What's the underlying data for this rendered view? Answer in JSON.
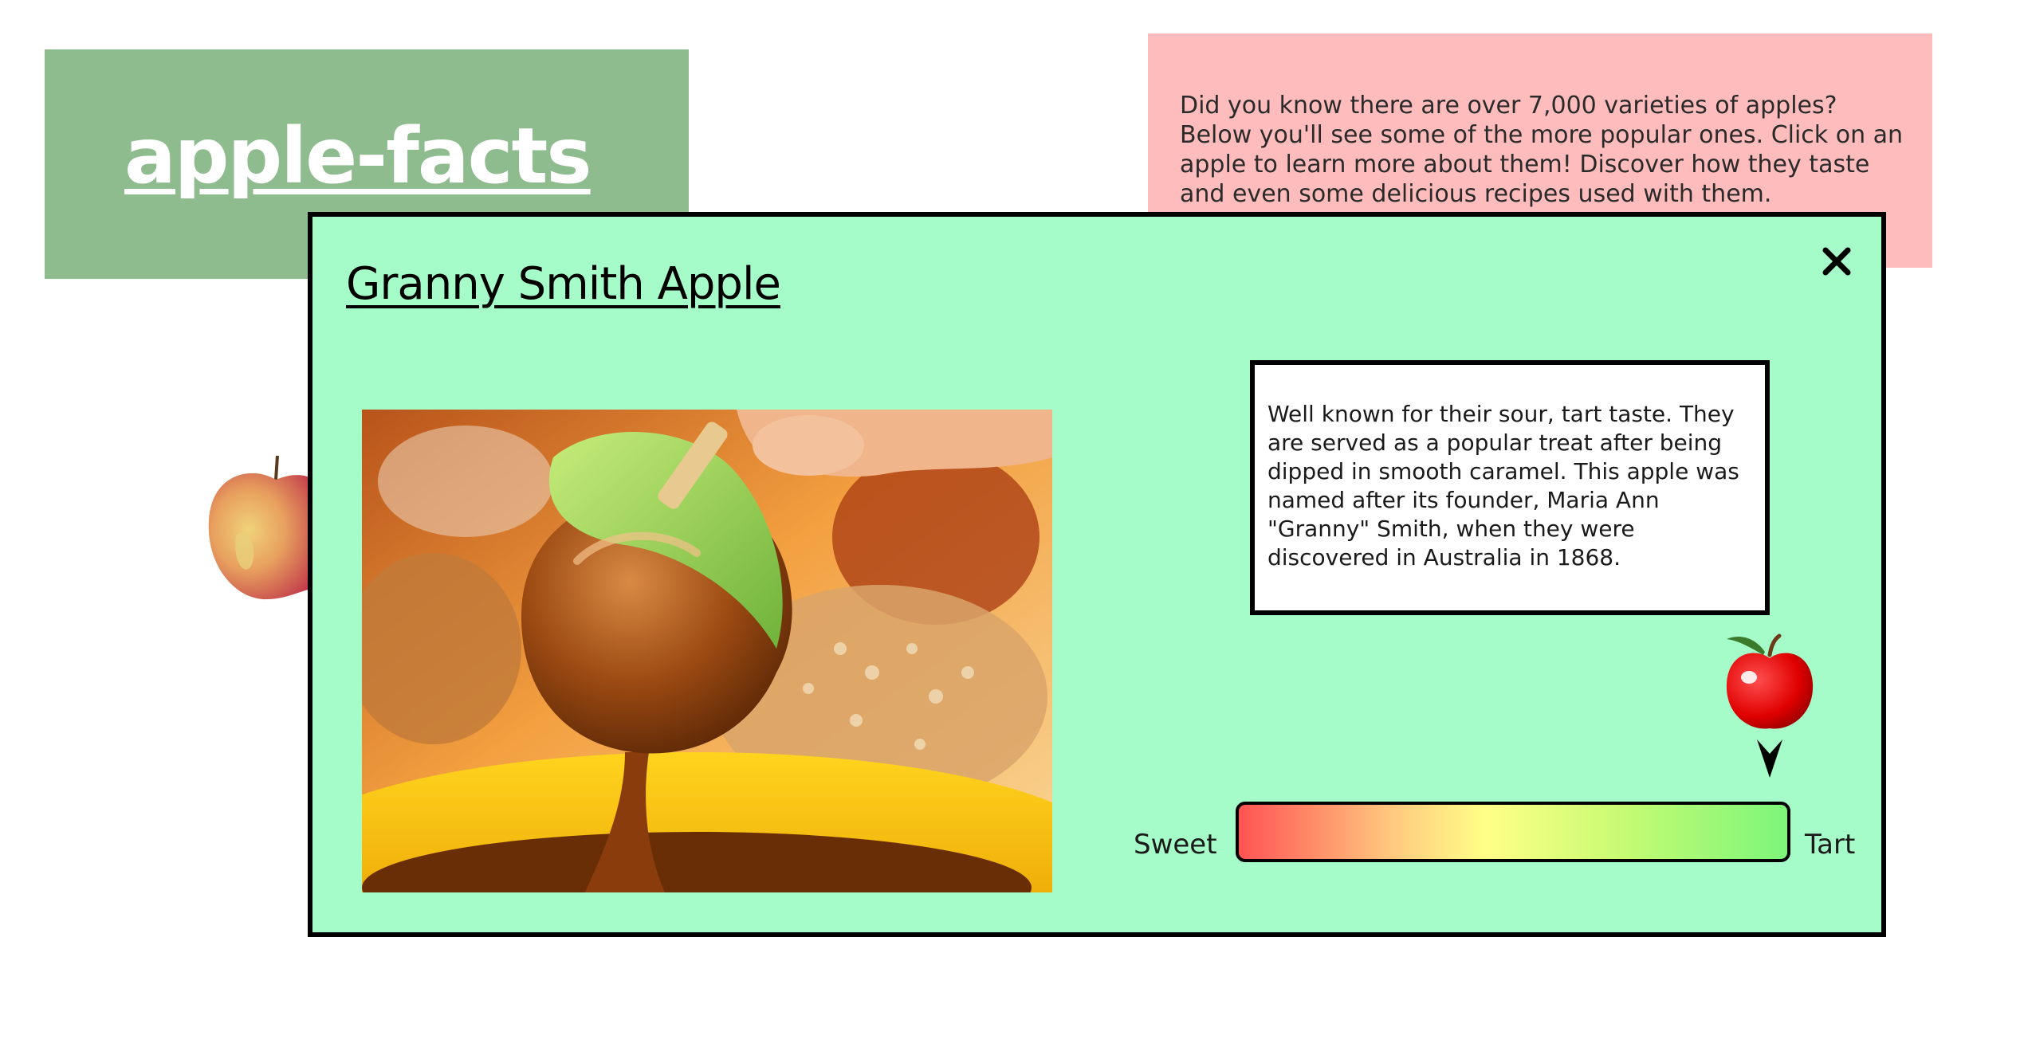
{
  "header": {
    "logo_text": "apple-facts",
    "intro_text": "Did you know there are over 7,000 varieties of apples? Below you'll see some of the more popular ones. Click on an apple to learn more about them! Discover how they taste and even some delicious recipes used with them."
  },
  "modal": {
    "title": "Granny Smith Apple",
    "close_icon": "close-icon",
    "description": "Well known for their sour, tart taste. They are served as a popular treat after being dipped in smooth caramel. This apple was named after its founder, Maria Ann \"Granny\" Smith, when they were discovered in Australia in 1868.",
    "scale": {
      "left_label": "Sweet",
      "right_label": "Tart",
      "level": 1.0,
      "marker_icon": "apple-marker-icon"
    }
  },
  "colors": {
    "logo_bg": "#8fbc8f",
    "intro_bg": "#ffbcbc",
    "modal_bg": "#a6fcc8",
    "scale_start": "#ff5353",
    "scale_mid": "#ffff87",
    "scale_end": "#7cf67a"
  }
}
